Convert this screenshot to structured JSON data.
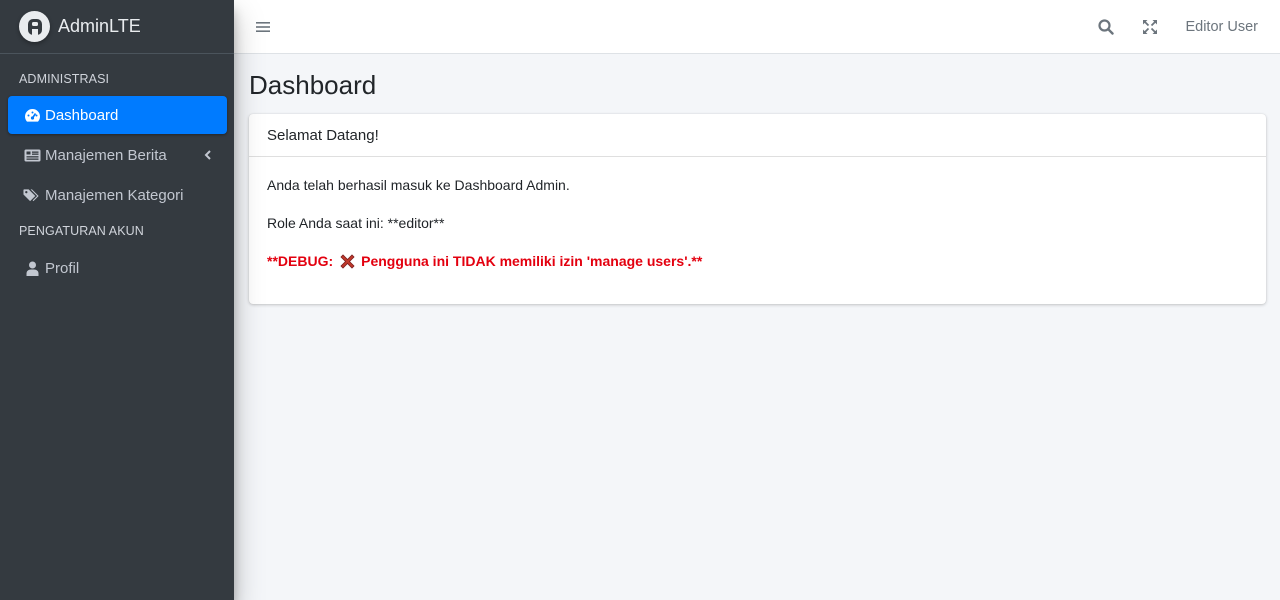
{
  "brand": {
    "name_bold": "Admin",
    "name_light": "LTE"
  },
  "sidebar": {
    "sections": [
      {
        "header": "ADMINISTRASI"
      },
      {
        "header": "PENGATURAN AKUN"
      }
    ],
    "items": [
      {
        "label": "Dashboard",
        "icon": "tachometer-icon",
        "active": true
      },
      {
        "label": "Manajemen Berita",
        "icon": "newspaper-icon",
        "has_submenu": true
      },
      {
        "label": "Manajemen Kategori",
        "icon": "tags-icon"
      },
      {
        "label": "Profil",
        "icon": "user-icon"
      }
    ]
  },
  "topbar": {
    "menu_icon": "hamburger-icon",
    "search_icon": "search-icon",
    "fullscreen_icon": "expand-icon",
    "user_name": "Editor User"
  },
  "page": {
    "title": "Dashboard",
    "card": {
      "header": "Selamat Datang!",
      "line1": "Anda telah berhasil masuk ke Dashboard Admin.",
      "line2": "Role Anda saat ini: **editor**",
      "debug_prefix": "**DEBUG:",
      "debug_message": "Pengguna ini TIDAK memiliki izin 'manage users'.**"
    }
  },
  "colors": {
    "sidebar_bg": "#343a40",
    "accent": "#007bff",
    "debug_red": "#e3000f",
    "content_bg": "#f4f6f9"
  }
}
